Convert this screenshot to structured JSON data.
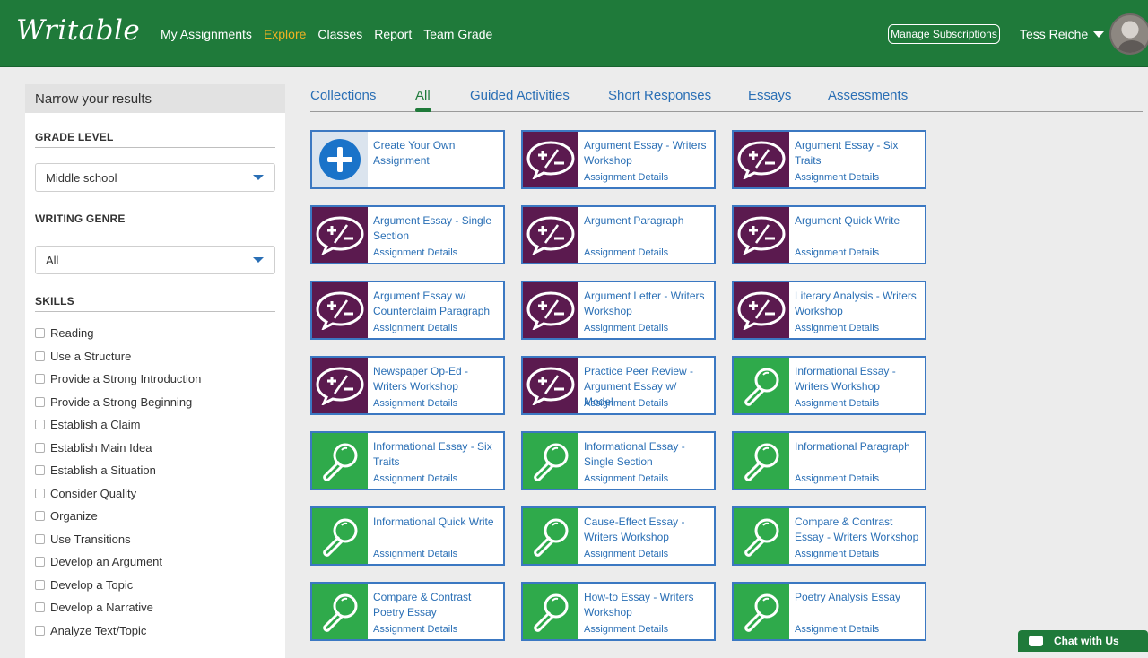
{
  "header": {
    "logo": "Writable",
    "nav": [
      {
        "label": "My Assignments",
        "active": false
      },
      {
        "label": "Explore",
        "active": true
      },
      {
        "label": "Classes",
        "active": false
      },
      {
        "label": "Report",
        "active": false
      },
      {
        "label": "Team Grade",
        "active": false
      }
    ],
    "manage_label": "Manage Subscriptions",
    "user_name": "Tess Reiche"
  },
  "sidebar": {
    "title": "Narrow your results",
    "grade_label": "GRADE LEVEL",
    "grade_value": "Middle school",
    "genre_label": "WRITING GENRE",
    "genre_value": "All",
    "skills_label": "SKILLS",
    "skills": [
      "Reading",
      "Use a Structure",
      "Provide a Strong Introduction",
      "Provide a Strong Beginning",
      "Establish a Claim",
      "Establish Main Idea",
      "Establish a Situation",
      "Consider Quality",
      "Organize",
      "Use Transitions",
      "Develop an Argument",
      "Develop a Topic",
      "Develop a Narrative",
      "Analyze Text/Topic"
    ]
  },
  "tabs": [
    {
      "label": "Collections",
      "active": false
    },
    {
      "label": "All",
      "active": true
    },
    {
      "label": "Guided Activities",
      "active": false
    },
    {
      "label": "Short Responses",
      "active": false
    },
    {
      "label": "Essays",
      "active": false
    },
    {
      "label": "Assessments",
      "active": false
    }
  ],
  "cards": [
    {
      "title": "Create Your Own Assignment",
      "details": "",
      "icon": "plus-circle-icon",
      "kind": "create"
    },
    {
      "title": "Argument Essay - Writers Workshop",
      "details": "Assignment Details",
      "icon": "plus-minus-bubble-icon",
      "kind": "purple"
    },
    {
      "title": "Argument Essay - Six Traits",
      "details": "Assignment Details",
      "icon": "plus-minus-bubble-icon",
      "kind": "purple"
    },
    {
      "title": "Argument Essay - Single Section",
      "details": "Assignment Details",
      "icon": "plus-minus-bubble-icon",
      "kind": "purple"
    },
    {
      "title": "Argument Paragraph",
      "details": "Assignment Details",
      "icon": "plus-minus-bubble-icon",
      "kind": "purple"
    },
    {
      "title": "Argument Quick Write",
      "details": "Assignment Details",
      "icon": "plus-minus-bubble-icon",
      "kind": "purple"
    },
    {
      "title": "Argument Essay w/ Counterclaim Paragraph",
      "details": "Assignment Details",
      "icon": "plus-minus-bubble-icon",
      "kind": "purple"
    },
    {
      "title": "Argument Letter - Writers Workshop",
      "details": "Assignment Details",
      "icon": "plus-minus-bubble-icon",
      "kind": "purple"
    },
    {
      "title": "Literary Analysis - Writers Workshop",
      "details": "Assignment Details",
      "icon": "plus-minus-bubble-icon",
      "kind": "purple"
    },
    {
      "title": "Newspaper Op-Ed - Writers Workshop",
      "details": "Assignment Details",
      "icon": "plus-minus-bubble-icon",
      "kind": "purple"
    },
    {
      "title": "Practice Peer Review - Argument Essay w/ Model",
      "details": "Assignment Details",
      "icon": "plus-minus-bubble-icon",
      "kind": "purple"
    },
    {
      "title": "Informational Essay - Writers Workshop",
      "details": "Assignment Details",
      "icon": "magnifier-icon",
      "kind": "green"
    },
    {
      "title": "Informational Essay - Six Traits",
      "details": "Assignment Details",
      "icon": "magnifier-icon",
      "kind": "green"
    },
    {
      "title": "Informational Essay - Single Section",
      "details": "Assignment Details",
      "icon": "magnifier-icon",
      "kind": "green"
    },
    {
      "title": "Informational Paragraph",
      "details": "Assignment Details",
      "icon": "magnifier-icon",
      "kind": "green"
    },
    {
      "title": "Informational Quick Write",
      "details": "Assignment Details",
      "icon": "magnifier-icon",
      "kind": "green"
    },
    {
      "title": "Cause-Effect Essay - Writers Workshop",
      "details": "Assignment Details",
      "icon": "magnifier-icon",
      "kind": "green"
    },
    {
      "title": "Compare & Contrast Essay - Writers Workshop",
      "details": "Assignment Details",
      "icon": "magnifier-icon",
      "kind": "green"
    },
    {
      "title": "Compare & Contrast Poetry Essay",
      "details": "Assignment Details",
      "icon": "magnifier-icon",
      "kind": "green"
    },
    {
      "title": "How-to Essay - Writers Workshop",
      "details": "Assignment Details",
      "icon": "magnifier-icon",
      "kind": "green"
    },
    {
      "title": "Poetry Analysis Essay",
      "details": "Assignment Details",
      "icon": "magnifier-icon",
      "kind": "green"
    }
  ],
  "chat_label": "Chat with Us",
  "colors": {
    "brand_green": "#1f7a3a",
    "active_nav": "#f0b323",
    "link_blue": "#2a6fb5",
    "argument_purple": "#5b1a4f",
    "informational_green": "#2faa4b"
  }
}
